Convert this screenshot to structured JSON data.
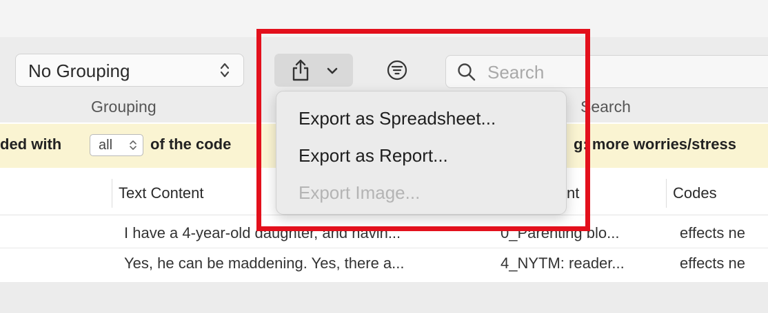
{
  "toolbar": {
    "grouping_value": "No Grouping",
    "grouping_caption": "Grouping",
    "search_placeholder": "Search",
    "search_caption": "Search"
  },
  "export_menu": {
    "items": [
      {
        "label": "Export as Spreadsheet...",
        "enabled": true
      },
      {
        "label": "Export as Report...",
        "enabled": true
      },
      {
        "label": "Export Image...",
        "enabled": false
      }
    ]
  },
  "filter_bar": {
    "prefix": "ded with",
    "select_value": "all",
    "middle": "of the code",
    "suffix": "g: more worries/stress"
  },
  "table": {
    "columns": [
      "Text Content",
      "nt",
      "Codes"
    ],
    "rows": [
      {
        "text": "I have a 4-year-old daughter, and havin...",
        "document": "0_Parenting blo...",
        "codes": "effects ne"
      },
      {
        "text": "Yes, he can be maddening. Yes, there a...",
        "document": "4_NYTM: reader...",
        "codes": "effects ne"
      }
    ]
  },
  "colors": {
    "highlight": "#e3101c",
    "filter_bar_bg": "#faf4d2"
  }
}
